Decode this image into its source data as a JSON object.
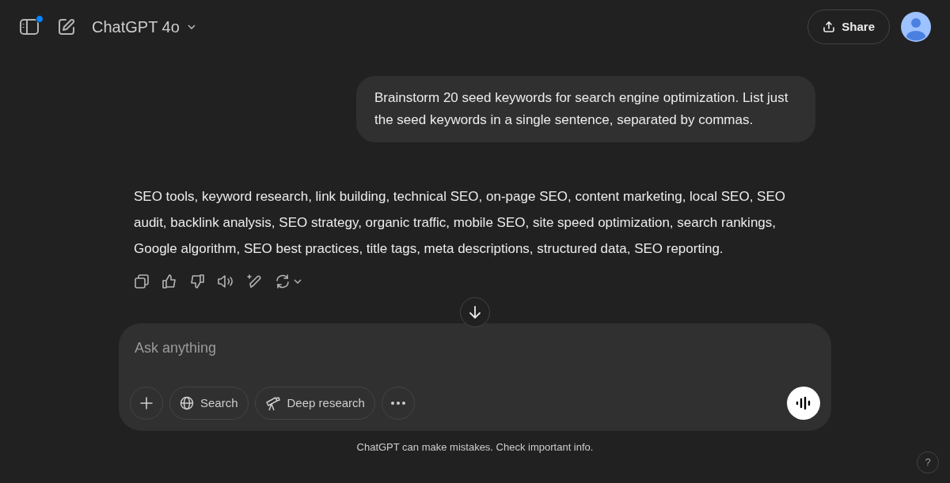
{
  "header": {
    "model": "ChatGPT 4o",
    "notification_dot": true,
    "share": "Share"
  },
  "user_message": "Brainstorm 20 seed keywords for search engine optimization. List just the seed keywords in a single sentence, separated by commas.",
  "assistant_message": "SEO tools, keyword research, link building, technical SEO, on-page SEO, content marketing, local SEO, SEO audit, backlink analysis, SEO strategy, organic traffic, mobile SEO, site speed optimization, search rankings, Google algorithm, SEO best practices, title tags, meta descriptions, structured data, SEO reporting.",
  "composer": {
    "placeholder": "Ask anything",
    "tools": [
      {
        "kind": "search",
        "label": "Search"
      },
      {
        "kind": "deep",
        "label": "Deep research"
      }
    ]
  },
  "footer": "ChatGPT can make mistakes. Check important info.",
  "help": "?"
}
